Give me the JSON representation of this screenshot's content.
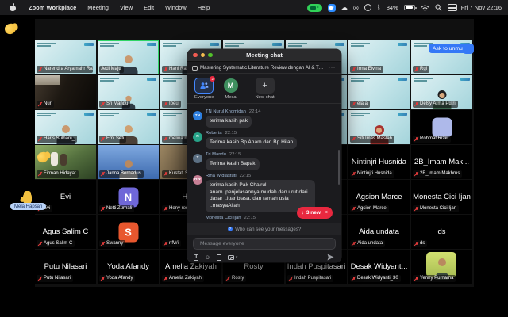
{
  "menu_bar": {
    "items": [
      "Zoom Workplace",
      "Meeting",
      "View",
      "Edit",
      "Window",
      "Help"
    ],
    "battery_percent": "84%",
    "clock": "Fri 7 Nov 22:16"
  },
  "meeting": {
    "ask_to_unmute_label": "Ask to unmute",
    "more_label": "···",
    "raised_reaction_name": "Mela Hapsari",
    "accent_active_border": "#2fd566",
    "tiles": [
      {
        "row": 1,
        "col": 1,
        "kind": "teal",
        "label": "Narendra Aryamahr Raza",
        "muted": true
      },
      {
        "row": 1,
        "col": 2,
        "kind": "teal",
        "label": "Jedi Maju",
        "muted": false,
        "active": true,
        "person": "p-man"
      },
      {
        "row": 1,
        "col": 3,
        "kind": "teal",
        "label": "Hani Raha...",
        "muted": true,
        "person": "p-man"
      },
      {
        "row": 1,
        "col": 4,
        "kind": "teal",
        "label": "",
        "muted": false
      },
      {
        "row": 1,
        "col": 5,
        "kind": "teal",
        "label": "",
        "muted": false
      },
      {
        "row": 1,
        "col": 6,
        "kind": "teal",
        "label": "Irma Elvina",
        "muted": true
      },
      {
        "row": 1,
        "col": 7,
        "kind": "teal",
        "label": "Rgl",
        "muted": true
      },
      {
        "row": 2,
        "col": 1,
        "kind": "photo",
        "photo": "ph-darkroom",
        "label": "Nur",
        "muted": true
      },
      {
        "row": 2,
        "col": 2,
        "kind": "teal",
        "label": "Sri Mandu",
        "muted": true,
        "person": "p-small"
      },
      {
        "row": 2,
        "col": 3,
        "kind": "teal",
        "label": "Ibeu",
        "muted": true
      },
      {
        "row": 2,
        "col": 4,
        "kind": "teal",
        "label": "",
        "muted": false
      },
      {
        "row": 2,
        "col": 5,
        "kind": "teal",
        "label": "",
        "muted": false
      },
      {
        "row": 2,
        "col": 6,
        "kind": "teal",
        "label": "ela a",
        "muted": true
      },
      {
        "row": 2,
        "col": 7,
        "kind": "teal",
        "label": "Delsy Arma Putri",
        "muted": true,
        "person": "p-hair"
      },
      {
        "row": 3,
        "col": 1,
        "kind": "teal",
        "label": "Haris Sulhani_",
        "muted": true,
        "person": "p-man"
      },
      {
        "row": 3,
        "col": 2,
        "kind": "teal",
        "label": "Emi Seti",
        "muted": true,
        "person": "p-skin"
      },
      {
        "row": 3,
        "col": 3,
        "kind": "teal",
        "label": "melina ni...",
        "muted": true,
        "person": "p-dark"
      },
      {
        "row": 3,
        "col": 4,
        "kind": "teal",
        "label": "",
        "muted": false
      },
      {
        "row": 3,
        "col": 5,
        "kind": "teal",
        "label": "",
        "muted": false
      },
      {
        "row": 3,
        "col": 6,
        "kind": "teal",
        "label": "Siti Imas Maslah",
        "muted": true,
        "person": "p-hijab"
      },
      {
        "row": 3,
        "col": 7,
        "kind": "avatar",
        "avatar_color": "#aeb9ea",
        "avatar_letter": "",
        "label": "Rohmat Rizki",
        "muted": true
      },
      {
        "row": 4,
        "col": 1,
        "kind": "photo",
        "photo": "ph-outdoor",
        "label": "Firman Hidayat",
        "muted": true
      },
      {
        "row": 4,
        "col": 2,
        "kind": "photo",
        "photo": "ph-blue",
        "label": "Janna Bernadus",
        "muted": true,
        "person": "p-shirt"
      },
      {
        "row": 4,
        "col": 3,
        "kind": "photo",
        "photo": "ph-tan",
        "label": "Kustati SL...",
        "muted": true
      },
      {
        "row": 4,
        "col": 4,
        "kind": "name",
        "display": "",
        "label": "",
        "muted": false
      },
      {
        "row": 4,
        "col": 5,
        "kind": "name",
        "display": "",
        "label": "",
        "muted": false
      },
      {
        "row": 4,
        "col": 6,
        "kind": "name",
        "display": "Nintinjri Husnida",
        "label": "Nintinjri Husnida",
        "muted": true
      },
      {
        "row": 4,
        "col": 7,
        "kind": "name",
        "display": "2B_Imam Mak...",
        "label": "2B_Imam Makhrus",
        "muted": true
      },
      {
        "row": 5,
        "col": 1,
        "kind": "name",
        "display": "Evi",
        "label": "Evi",
        "muted": true
      },
      {
        "row": 5,
        "col": 2,
        "kind": "avatar",
        "avatar_color": "#6f67d8",
        "avatar_letter": "N",
        "label": "Netti Zurnali",
        "muted": true
      },
      {
        "row": 5,
        "col": 3,
        "kind": "name",
        "display": "Heny",
        "label": "Heny rosa",
        "muted": true
      },
      {
        "row": 5,
        "col": 4,
        "kind": "name",
        "display": "",
        "label": "",
        "muted": false
      },
      {
        "row": 5,
        "col": 5,
        "kind": "name",
        "display": "",
        "label": "",
        "muted": false
      },
      {
        "row": 5,
        "col": 6,
        "kind": "name",
        "display": "Agsion Marce",
        "label": "Agsion Marce",
        "muted": true
      },
      {
        "row": 5,
        "col": 7,
        "kind": "name",
        "display": "Monesta Cici Ijan",
        "label": "Monesta Cici Ijan",
        "muted": true
      },
      {
        "row": 6,
        "col": 1,
        "kind": "name",
        "display": "Agus Salim C",
        "label": "Agus Salim C",
        "muted": true
      },
      {
        "row": 6,
        "col": 2,
        "kind": "avatar",
        "avatar_color": "#e8572e",
        "avatar_letter": "S",
        "label": "Swanny",
        "muted": true
      },
      {
        "row": 6,
        "col": 3,
        "kind": "name",
        "display": "",
        "label": "nfWi",
        "muted": true
      },
      {
        "row": 6,
        "col": 4,
        "kind": "name",
        "display": "",
        "label": "",
        "muted": false
      },
      {
        "row": 6,
        "col": 5,
        "kind": "name",
        "display": "",
        "label": "",
        "muted": false
      },
      {
        "row": 6,
        "col": 6,
        "kind": "name",
        "display": "Aida undata",
        "label": "Aida undata",
        "muted": true
      },
      {
        "row": 6,
        "col": 7,
        "kind": "name",
        "display": "ds",
        "label": "ds",
        "muted": true
      },
      {
        "row": 7,
        "col": 1,
        "kind": "name",
        "display": "Putu Nilasari",
        "label": "Putu Nilasari",
        "muted": true
      },
      {
        "row": 7,
        "col": 2,
        "kind": "name",
        "display": "Yoda Afandy",
        "label": "Yoda Afandy",
        "muted": true
      },
      {
        "row": 7,
        "col": 3,
        "kind": "name",
        "display": "Amelia Zakiyah",
        "label": "Amelia Zakiyah",
        "muted": true
      },
      {
        "row": 7,
        "col": 4,
        "kind": "name",
        "display": "Rosty",
        "label": "Rosty",
        "muted": true
      },
      {
        "row": 7,
        "col": 5,
        "kind": "name",
        "display": "Indah Puspitasari",
        "label": "Indah Puspitasari",
        "muted": true
      },
      {
        "row": 7,
        "col": 6,
        "kind": "name",
        "display": "Desak Widyant...",
        "label": "Desak Widyanti_30",
        "muted": true
      },
      {
        "row": 7,
        "col": 7,
        "kind": "photo",
        "photo": "ph-yenny",
        "label": "Yenny Purnama",
        "muted": true,
        "person": "p-yenny"
      }
    ]
  },
  "chat": {
    "window_title": "Meeting chat",
    "topic": "Mastering Systematic Literature Review dengan AI & Tool...",
    "topic_more": "···",
    "tabs": {
      "everyone": "Everyone",
      "everyone_badge": "2",
      "direct": "Mesa",
      "new_chat": "New chat"
    },
    "messages": [
      {
        "initials": "TN",
        "avatar_color": "#2d7fe0",
        "name": "TN Nurul Khomidah",
        "time": "22:14",
        "text": "terima kasih pak"
      },
      {
        "initials": "R",
        "avatar_color": "#27a389",
        "name": "Roberta",
        "time": "22:15",
        "text": "Terima kasih Bp Anam dan Bp Hilan"
      },
      {
        "initials": "T",
        "avatar_color": "#5c7083",
        "name": "Tri Mandu",
        "time": "22:15",
        "text": "Terima kasih Bapak"
      },
      {
        "initials": "RW",
        "avatar_color": "#c77f95",
        "name": "Rina Widiastuti",
        "time": "22:15",
        "text": "terima kasih Pak Chairul anam..penjelasannya mudah dan urut dari dasar ..luar biasa..dan ramah usia ..masyaAllah"
      },
      {
        "initials": "M",
        "avatar_color": "#8a64d8",
        "name": "Monesta Cici Ijan",
        "time": "22:15",
        "text": ""
      }
    ],
    "new_messages_arrow": "↓",
    "new_messages_label": "3 new",
    "new_messages_close": "×",
    "privacy_note": "Who can see your messages?",
    "input_placeholder": "Message everyone",
    "accent_red": "#e8283f",
    "accent_blue": "#4387ff"
  }
}
